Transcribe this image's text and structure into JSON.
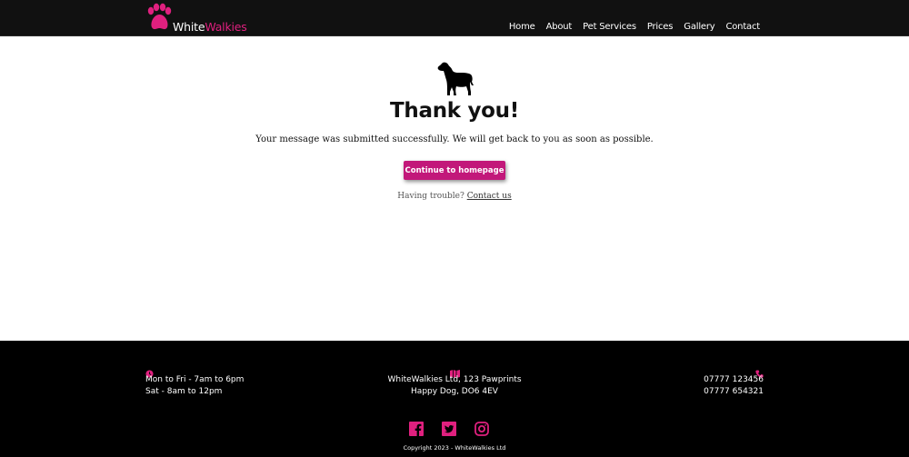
{
  "header": {
    "logo_white": "White",
    "logo_pink": "Walkies",
    "nav": [
      {
        "label": "Home"
      },
      {
        "label": "About"
      },
      {
        "label": "Pet Services"
      },
      {
        "label": "Prices"
      },
      {
        "label": "Gallery"
      },
      {
        "label": "Contact"
      }
    ]
  },
  "main": {
    "title": "Thank you!",
    "message": "Your message was submitted successfully. We will get back to you as soon as possible.",
    "button_label": "Continue to homepage",
    "trouble_text": "Having trouble?",
    "contact_link": "Contact us"
  },
  "footer": {
    "hours": [
      "Mon to Fri - 7am to 6pm",
      "Sat - 8am to 12pm"
    ],
    "address": [
      "WhiteWalkies Ltd, 123 Pawprints",
      "Happy Dog, DO6 4EV"
    ],
    "phones": [
      "07777 123456",
      "07777 654321"
    ],
    "copyright": "Copyright 2023 - WhiteWalkies Ltd"
  },
  "icons": {
    "logo": "paw-icon",
    "hero": "dog-silhouette-icon",
    "hours": "clock-icon",
    "address": "map-icon",
    "phone": "phone-icon",
    "social": [
      "facebook-icon",
      "twitter-icon",
      "instagram-icon"
    ]
  },
  "colors": {
    "brand_pink": "#e0207f",
    "button": "#c2187a",
    "header_bg": "#111111",
    "footer_bg": "#000000"
  }
}
